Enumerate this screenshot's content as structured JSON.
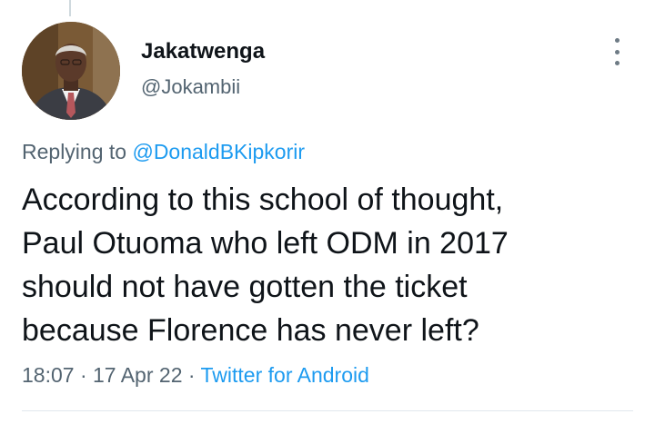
{
  "tweet": {
    "author": {
      "display_name": "Jakatwenga",
      "handle": "@Jokambii"
    },
    "replying_prefix": "Replying to",
    "replying_to": "@DonaldBKipkorir",
    "text_lines": [
      "According to this school of thought,",
      "Paul Otuoma who left ODM in 2017",
      "should not have gotten the ticket",
      "because Florence has never left?"
    ],
    "time": "18:07",
    "separator": "·",
    "date": "17 Apr 22",
    "source": "Twitter for Android",
    "icons": {
      "avatar": "profile-photo",
      "more": "more-vertical-icon"
    },
    "colors": {
      "link": "#1d9bf0",
      "secondary_text": "#536471",
      "primary_text": "#0f1419"
    }
  }
}
